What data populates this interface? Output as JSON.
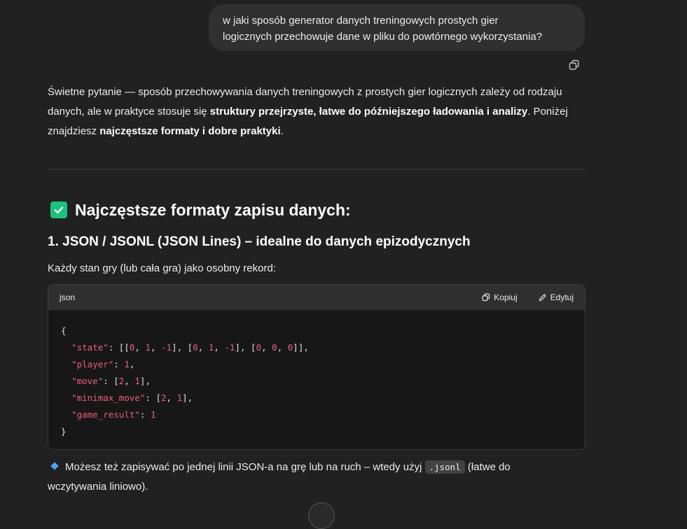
{
  "user_message": {
    "line1": "w jaki sposób generator danych treningowych prostych gier",
    "line2": "logicznych przechowuje dane w pliku do powtórnego wykorzystania?"
  },
  "icons": {
    "copy_message": "copy-icon",
    "heading_check": "check-icon",
    "bullet": "diamond-icon"
  },
  "answer": {
    "intro_part1": "Świetne pytanie — sposób przechowywania danych treningowych z prostych gier logicznych zależy od rodzaju danych, ale w praktyce stosuje się ",
    "intro_bold1": "struktury przejrzyste, łatwe do późniejszego ładowania i analizy",
    "intro_part2": ". Poniżej znajdziesz ",
    "intro_bold2": "najczęstsze formaty i dobre praktyki",
    "intro_part3": ".",
    "heading": "Najczęstsze formaty zapisu danych:",
    "subheading": "1. JSON / JSONL (JSON Lines) – idealne do danych epizodycznych",
    "code_intro": "Każdy stan gry (lub cała gra) jako osobny rekord:",
    "code_block": {
      "language": "json",
      "copy_label": "Kopiuj",
      "edit_label": "Edytuj",
      "lines": [
        "{",
        "  \"state\": [[0, 1, -1], [0, 1, -1], [0, 0, 0]],",
        "  \"player\": 1,",
        "  \"move\": [2, 1],",
        "  \"minimax_move\": [2, 1],",
        "  \"game_result\": 1",
        "}"
      ]
    },
    "tip_part1": "Możesz też zapisywać po jednej linii JSON-a na grę lub na ruch – wtedy użyj ",
    "tip_code": ".jsonl",
    "tip_part2": " (łatwe do wczytywania liniowo)."
  },
  "colors": {
    "background": "#212121",
    "user_bubble": "#303030",
    "check_green": "#19c37d",
    "code_number": "#e95f7c",
    "bullet_blue": "#4ea1f5"
  }
}
